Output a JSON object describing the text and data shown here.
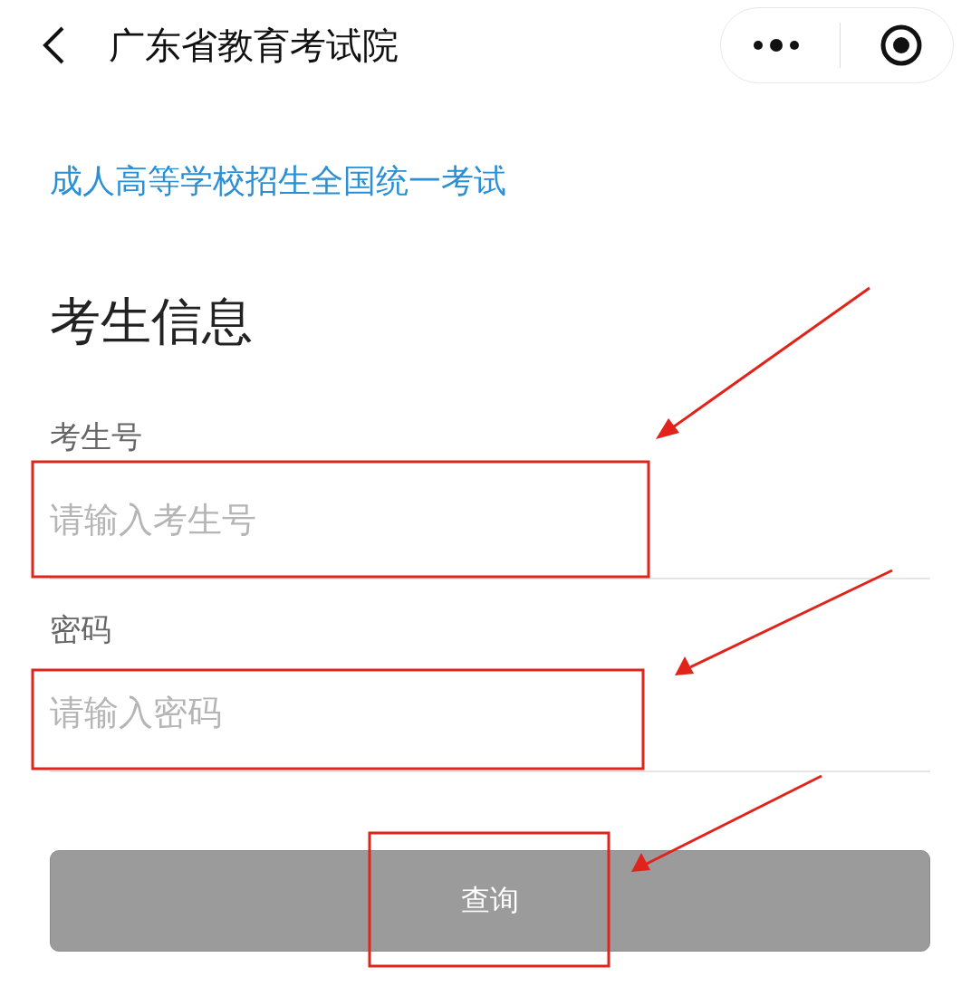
{
  "header": {
    "title": "广东省教育考试院"
  },
  "exam_link": "成人高等学校招生全国统一考试",
  "section_title": "考生信息",
  "fields": [
    {
      "label": "考生号",
      "placeholder": "请输入考生号"
    },
    {
      "label": "密码",
      "placeholder": "请输入密码"
    }
  ],
  "query_button": {
    "label": "查询",
    "disabled": true
  }
}
